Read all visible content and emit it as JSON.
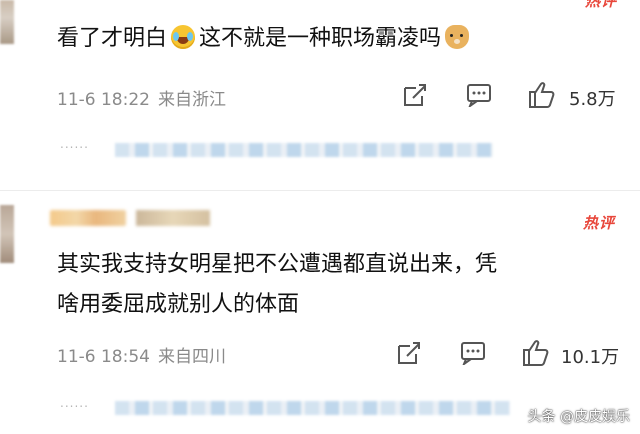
{
  "comments": [
    {
      "badge": "热评",
      "text_part1": "看了才明白",
      "emoji1": "laughing-crying-emoji",
      "text_part2": "这不就是一种职场霸凌吗",
      "emoji2": "doge-emoji",
      "date": "11-6 18:22",
      "location": "来自浙江",
      "likes": "5.8万"
    },
    {
      "badge": "热评",
      "text_line1": "其实我支持女明星把不公遭遇都直说出来，凭",
      "text_line2": "啥用委屈成就别人的体面",
      "date": "11-6 18:54",
      "location": "来自四川",
      "likes": "10.1万"
    }
  ],
  "more_dots": "......",
  "watermark": "头条 @皮皮娱乐",
  "colors": {
    "badge": "#e8473b",
    "meta": "#8a8a8a",
    "text": "#111111"
  },
  "icons": [
    "repost-icon",
    "comment-icon",
    "like-icon"
  ]
}
